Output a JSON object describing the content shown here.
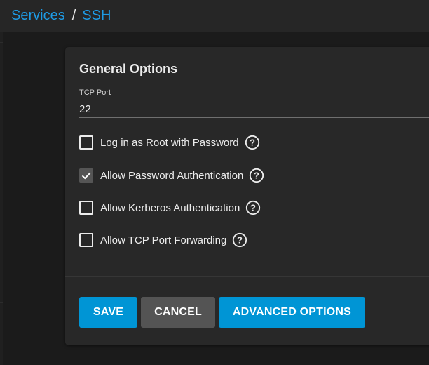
{
  "breadcrumb": {
    "items": [
      "Services",
      "SSH"
    ],
    "separator": "/"
  },
  "card": {
    "title": "General Options",
    "tcp_port": {
      "label": "TCP Port",
      "value": "22"
    },
    "options": [
      {
        "label": "Log in as Root with Password",
        "checked": false
      },
      {
        "label": "Allow Password Authentication",
        "checked": true
      },
      {
        "label": "Allow Kerberos Authentication",
        "checked": false
      },
      {
        "label": "Allow TCP Port Forwarding",
        "checked": false
      }
    ]
  },
  "buttons": {
    "save": "SAVE",
    "cancel": "CANCEL",
    "advanced": "ADVANCED OPTIONS"
  },
  "colors": {
    "accent": "#0095d5",
    "link": "#1e9be5",
    "card_bg": "#282828",
    "page_bg": "#1b1b1b",
    "topbar_bg": "#262626",
    "cancel_bg": "#545454"
  },
  "icons": {
    "help": "help-circle-icon",
    "check": "check-icon"
  }
}
